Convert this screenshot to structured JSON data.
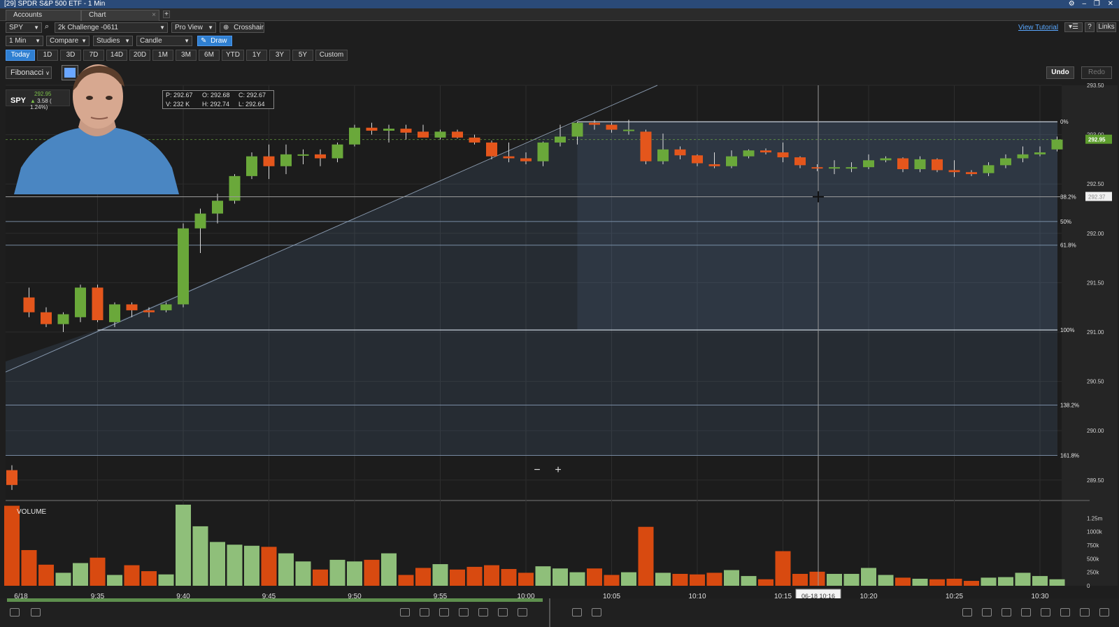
{
  "window": {
    "title": "[29] SPDR S&P 500 ETF - 1 Min",
    "controls": "⚙ – ❐ ✕"
  },
  "tabs": [
    {
      "label": "Accounts"
    },
    {
      "label": "Chart"
    }
  ],
  "toolbar": {
    "symbol": "SPY",
    "account": "2k Challenge -0611",
    "view": "Pro View",
    "crosshair_label": "Crosshair",
    "view_tutorial": "View Tutorial",
    "help": "?",
    "links": "Links"
  },
  "toolbar2": {
    "interval": "1 Min",
    "compare": "Compare",
    "studies": "Studies",
    "chart_type": "Candle",
    "draw_label": "Draw"
  },
  "ranges": [
    "Today",
    "1D",
    "3D",
    "7D",
    "14D",
    "20D",
    "1M",
    "3M",
    "6M",
    "YTD",
    "1Y",
    "3Y",
    "5Y",
    "Custom"
  ],
  "active_range": "Today",
  "drawbar": {
    "tool": "Fibonacci",
    "undo": "Undo",
    "redo": "Redo"
  },
  "quote": {
    "symbol": "SPY",
    "price": "292.95",
    "change": "3.58 ( 1.24%)"
  },
  "ohlc": {
    "p": "P: 292.67",
    "o": "O: 292.68",
    "c": "C: 292.67",
    "v": "V: 232 K",
    "h": "H: 292.74",
    "l": "L: 292.64"
  },
  "colors": {
    "up": "#6aa83a",
    "down": "#e4561c",
    "vol_up": "#8fbf7a",
    "vol_down": "#d84a10",
    "accent": "#2f7fd1"
  },
  "chart_data": {
    "type": "candlestick",
    "price_ylim": [
      289.3,
      293.5
    ],
    "price_ticks": [
      "293.50",
      "293.00",
      "292.50",
      "292.00",
      "291.50",
      "291.00",
      "290.50",
      "290.00",
      "289.50"
    ],
    "last_price": "292.95",
    "crosshair_price": "292.37",
    "crosshair_time": "06-18 10:16",
    "fib_levels": [
      {
        "label": "0%",
        "price": 293.13
      },
      {
        "label": "38.2%",
        "price": 292.37
      },
      {
        "label": "50%",
        "price": 292.12
      },
      {
        "label": "61.8%",
        "price": 291.88
      },
      {
        "label": "100%",
        "price": 291.02
      },
      {
        "label": "138.2%",
        "price": 290.26
      },
      {
        "label": "161.8%",
        "price": 289.75
      }
    ],
    "x_labels": [
      "6/18",
      "9:35",
      "9:40",
      "9:45",
      "9:50",
      "9:55",
      "10:00",
      "10:05",
      "10:10",
      "10:15",
      "10:20",
      "10:25",
      "10:30"
    ],
    "volume_label": "VOLUME",
    "volume_ticks": [
      "1.25m",
      "1000k",
      "750k",
      "500k",
      "250k",
      "0"
    ],
    "volume_ylim": [
      0,
      1500
    ],
    "candles": [
      {
        "t": "9:30",
        "o": 289.6,
        "h": 289.65,
        "l": 289.4,
        "c": 289.45
      },
      {
        "t": "9:31",
        "o": 291.35,
        "h": 291.45,
        "l": 291.15,
        "c": 291.2
      },
      {
        "t": "9:32",
        "o": 291.2,
        "h": 291.25,
        "l": 291.05,
        "c": 291.08
      },
      {
        "t": "9:33",
        "o": 291.08,
        "h": 291.2,
        "l": 291.0,
        "c": 291.18
      },
      {
        "t": "9:34",
        "o": 291.15,
        "h": 291.48,
        "l": 291.1,
        "c": 291.45
      },
      {
        "t": "9:35",
        "o": 291.45,
        "h": 291.48,
        "l": 291.1,
        "c": 291.12
      },
      {
        "t": "9:36",
        "o": 291.1,
        "h": 291.3,
        "l": 291.05,
        "c": 291.28
      },
      {
        "t": "9:37",
        "o": 291.28,
        "h": 291.3,
        "l": 291.15,
        "c": 291.22
      },
      {
        "t": "9:38",
        "o": 291.22,
        "h": 291.25,
        "l": 291.15,
        "c": 291.2
      },
      {
        "t": "9:39",
        "o": 291.22,
        "h": 291.3,
        "l": 291.2,
        "c": 291.28
      },
      {
        "t": "9:40",
        "o": 291.28,
        "h": 292.1,
        "l": 291.25,
        "c": 292.05
      },
      {
        "t": "9:41",
        "o": 292.05,
        "h": 292.25,
        "l": 291.8,
        "c": 292.2
      },
      {
        "t": "9:42",
        "o": 292.2,
        "h": 292.4,
        "l": 292.1,
        "c": 292.33
      },
      {
        "t": "9:43",
        "o": 292.33,
        "h": 292.6,
        "l": 292.3,
        "c": 292.58
      },
      {
        "t": "9:44",
        "o": 292.58,
        "h": 292.82,
        "l": 292.55,
        "c": 292.78
      },
      {
        "t": "9:45",
        "o": 292.78,
        "h": 292.9,
        "l": 292.55,
        "c": 292.68
      },
      {
        "t": "9:46",
        "o": 292.68,
        "h": 292.9,
        "l": 292.6,
        "c": 292.8
      },
      {
        "t": "9:47",
        "o": 292.8,
        "h": 292.85,
        "l": 292.7,
        "c": 292.8
      },
      {
        "t": "9:48",
        "o": 292.8,
        "h": 292.85,
        "l": 292.68,
        "c": 292.76
      },
      {
        "t": "9:49",
        "o": 292.76,
        "h": 292.92,
        "l": 292.72,
        "c": 292.9
      },
      {
        "t": "9:50",
        "o": 292.9,
        "h": 293.1,
        "l": 292.88,
        "c": 293.07
      },
      {
        "t": "9:51",
        "o": 293.07,
        "h": 293.12,
        "l": 293.0,
        "c": 293.04
      },
      {
        "t": "9:52",
        "o": 293.04,
        "h": 293.1,
        "l": 292.92,
        "c": 293.06
      },
      {
        "t": "9:53",
        "o": 293.06,
        "h": 293.1,
        "l": 292.95,
        "c": 293.02
      },
      {
        "t": "9:54",
        "o": 293.03,
        "h": 293.1,
        "l": 292.98,
        "c": 292.97
      },
      {
        "t": "9:55",
        "o": 292.97,
        "h": 293.05,
        "l": 292.95,
        "c": 293.03
      },
      {
        "t": "9:56",
        "o": 293.03,
        "h": 293.05,
        "l": 292.96,
        "c": 292.97
      },
      {
        "t": "9:57",
        "o": 292.97,
        "h": 293.0,
        "l": 292.9,
        "c": 292.92
      },
      {
        "t": "9:58",
        "o": 292.92,
        "h": 292.94,
        "l": 292.75,
        "c": 292.78
      },
      {
        "t": "9:59",
        "o": 292.78,
        "h": 292.92,
        "l": 292.72,
        "c": 292.76
      },
      {
        "t": "10:00",
        "o": 292.76,
        "h": 292.82,
        "l": 292.7,
        "c": 292.73
      },
      {
        "t": "10:01",
        "o": 292.73,
        "h": 292.93,
        "l": 292.68,
        "c": 292.92
      },
      {
        "t": "10:02",
        "o": 292.92,
        "h": 293.1,
        "l": 292.88,
        "c": 292.98
      },
      {
        "t": "10:03",
        "o": 292.98,
        "h": 293.13,
        "l": 292.9,
        "c": 293.12
      },
      {
        "t": "10:04",
        "o": 293.12,
        "h": 293.15,
        "l": 293.05,
        "c": 293.1
      },
      {
        "t": "10:05",
        "o": 293.1,
        "h": 293.12,
        "l": 293.02,
        "c": 293.05
      },
      {
        "t": "10:06",
        "o": 293.05,
        "h": 293.15,
        "l": 293.0,
        "c": 293.05
      },
      {
        "t": "10:07",
        "o": 293.03,
        "h": 293.05,
        "l": 292.7,
        "c": 292.73
      },
      {
        "t": "10:08",
        "o": 292.73,
        "h": 293.01,
        "l": 292.7,
        "c": 292.85
      },
      {
        "t": "10:09",
        "o": 292.85,
        "h": 292.88,
        "l": 292.75,
        "c": 292.79
      },
      {
        "t": "10:10",
        "o": 292.79,
        "h": 292.8,
        "l": 292.68,
        "c": 292.71
      },
      {
        "t": "10:11",
        "o": 292.7,
        "h": 292.82,
        "l": 292.66,
        "c": 292.68
      },
      {
        "t": "10:12",
        "o": 292.68,
        "h": 292.84,
        "l": 292.66,
        "c": 292.78
      },
      {
        "t": "10:13",
        "o": 292.78,
        "h": 292.85,
        "l": 292.76,
        "c": 292.84
      },
      {
        "t": "10:14",
        "o": 292.84,
        "h": 292.86,
        "l": 292.8,
        "c": 292.82
      },
      {
        "t": "10:15",
        "o": 292.82,
        "h": 292.92,
        "l": 292.72,
        "c": 292.77
      },
      {
        "t": "10:16",
        "o": 292.77,
        "h": 292.78,
        "l": 292.66,
        "c": 292.69
      },
      {
        "t": "10:17",
        "o": 292.67,
        "h": 292.7,
        "l": 292.63,
        "c": 292.66
      },
      {
        "t": "10:18",
        "o": 292.66,
        "h": 292.74,
        "l": 292.6,
        "c": 292.67
      },
      {
        "t": "10:19",
        "o": 292.66,
        "h": 292.72,
        "l": 292.62,
        "c": 292.67
      },
      {
        "t": "10:20",
        "o": 292.67,
        "h": 292.8,
        "l": 292.65,
        "c": 292.74
      },
      {
        "t": "10:21",
        "o": 292.74,
        "h": 292.78,
        "l": 292.72,
        "c": 292.76
      },
      {
        "t": "10:22",
        "o": 292.76,
        "h": 292.77,
        "l": 292.62,
        "c": 292.65
      },
      {
        "t": "10:23",
        "o": 292.65,
        "h": 292.78,
        "l": 292.62,
        "c": 292.75
      },
      {
        "t": "10:24",
        "o": 292.75,
        "h": 292.76,
        "l": 292.62,
        "c": 292.64
      },
      {
        "t": "10:25",
        "o": 292.64,
        "h": 292.74,
        "l": 292.57,
        "c": 292.62
      },
      {
        "t": "10:26",
        "o": 292.62,
        "h": 292.64,
        "l": 292.58,
        "c": 292.6
      },
      {
        "t": "10:27",
        "o": 292.61,
        "h": 292.72,
        "l": 292.58,
        "c": 292.69
      },
      {
        "t": "10:28",
        "o": 292.69,
        "h": 292.8,
        "l": 292.66,
        "c": 292.76
      },
      {
        "t": "10:29",
        "o": 292.76,
        "h": 292.88,
        "l": 292.72,
        "c": 292.8
      },
      {
        "t": "10:30",
        "o": 292.8,
        "h": 292.88,
        "l": 292.78,
        "c": 292.82
      },
      {
        "t": "10:31",
        "o": 292.85,
        "h": 292.98,
        "l": 292.83,
        "c": 292.95
      }
    ],
    "volumes": [
      1480,
      660,
      390,
      240,
      420,
      520,
      200,
      380,
      270,
      210,
      1500,
      1100,
      810,
      760,
      740,
      720,
      600,
      450,
      300,
      480,
      450,
      480,
      600,
      200,
      330,
      400,
      300,
      350,
      380,
      310,
      240,
      360,
      320,
      250,
      320,
      200,
      250,
      1090,
      240,
      220,
      210,
      240,
      290,
      180,
      120,
      640,
      220,
      260,
      220,
      220,
      330,
      200,
      150,
      130,
      120,
      130,
      90,
      150,
      160,
      240,
      180,
      120
    ]
  }
}
